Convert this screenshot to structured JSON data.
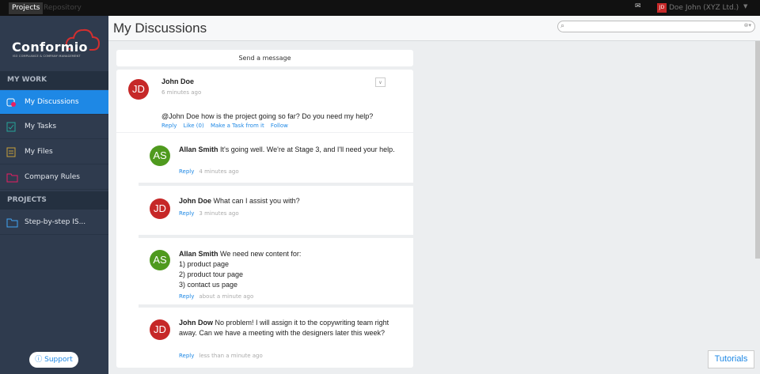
{
  "topbar": {
    "tabs": [
      "Projects",
      "Repository"
    ],
    "user": "Doe John (XYZ Ltd.)",
    "user_initials": "JD"
  },
  "sidebar": {
    "logo": "Conformio",
    "logo_sub": "ISO COMPLIANCE & COMPANY MANAGEMENT",
    "my_work_label": "MY WORK",
    "items": [
      {
        "label": "My Discussions",
        "icon": "discussions-icon"
      },
      {
        "label": "My Tasks",
        "icon": "tasks-icon"
      },
      {
        "label": "My Files",
        "icon": "files-icon"
      },
      {
        "label": "Company Rules",
        "icon": "folder-icon"
      }
    ],
    "projects_label": "PROJECTS",
    "projects": [
      {
        "label": "Step-by-step IS...",
        "icon": "folder-icon"
      }
    ],
    "support": "Support"
  },
  "main": {
    "title": "My Discussions",
    "send_message": "Send a message",
    "post": {
      "initials": "JD",
      "author": "John Doe",
      "time": "6 minutes ago",
      "text": "@John Doe how is the project going so far? Do you need my help?",
      "actions": [
        "Reply",
        "Like (0)",
        "Make a Task from it",
        "Follow"
      ]
    },
    "replies": [
      {
        "initials": "AS",
        "author": "Allan Smith",
        "text": "It's going well. We're at Stage 3, and I'll need your help.",
        "reply": "Reply",
        "time": "4 minutes ago"
      },
      {
        "initials": "JD",
        "author": "John Doe",
        "text": "What can I assist you with?",
        "reply": "Reply",
        "time": "3 minutes ago"
      },
      {
        "initials": "AS",
        "author": "Allan Smith",
        "text": "We need new content for:",
        "lines": [
          "1) product page",
          "2) product tour page",
          "3) contact us page"
        ],
        "reply": "Reply",
        "time": "about a minute ago"
      },
      {
        "initials": "JD",
        "author": "John Dow",
        "text": "No problem! I will assign it to the copywriting team right away. Can we have a meeting with the designers later this week?",
        "reply": "Reply",
        "time": "less than a minute ago"
      }
    ]
  },
  "tutorials": "Tutorials",
  "colors": {
    "accent": "#1e88e5",
    "sidebar": "#2f3b4e",
    "jd_avatar": "#c62828",
    "as_avatar": "#4f9a1e"
  }
}
